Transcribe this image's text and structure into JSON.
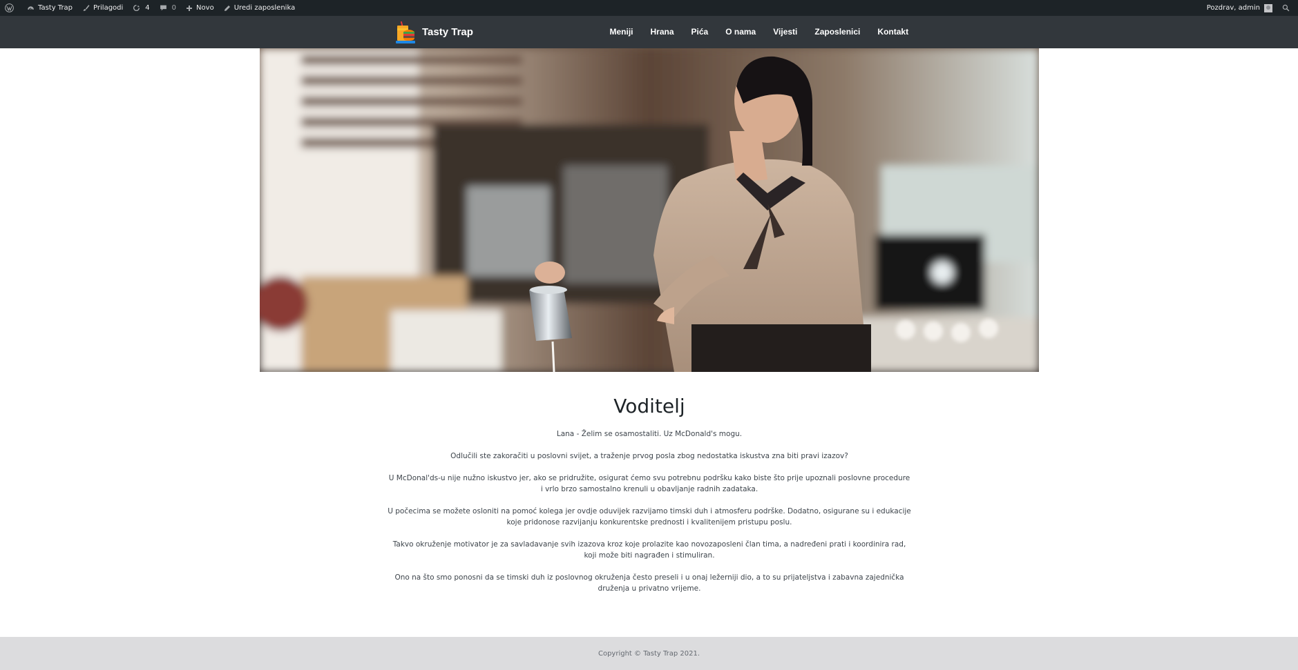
{
  "adminbar": {
    "site_name": "Tasty Trap",
    "customize": "Prilagodi",
    "updates_count": "4",
    "comments_count": "0",
    "new": "Novo",
    "edit": "Uredi zaposlenika",
    "greeting": "Pozdrav, admin"
  },
  "header": {
    "site_title": "Tasty Trap",
    "nav": [
      "Meniji",
      "Hrana",
      "Pića",
      "O nama",
      "Vijesti",
      "Zaposlenici",
      "Kontakt"
    ]
  },
  "hero": {
    "description": "Photo of a barista in a beige shirt and striped neck scarf pouring milk from a steel jug in a café"
  },
  "article": {
    "title": "Voditelj",
    "paragraphs": [
      "Lana - Želim se osamostaliti. Uz McDonald's mogu.",
      "Odlučili ste zakoračiti u poslovni svijet, a traženje prvog posla zbog nedostatka iskustva zna biti pravi izazov?",
      "U McDonal'ds-u nije nužno iskustvo jer, ako se pridružite, osigurat ćemo svu potrebnu podršku kako biste što prije upoznali poslovne procedure i vrlo brzo samostalno krenuli u obavljanje radnih zadataka.",
      "U počecima se možete osloniti na pomoć kolega jer ovdje oduvijek razvijamo timski duh i atmosferu podrške. Dodatno, osigurane su i edukacije koje pridonose razvijanju konkurentske prednosti i kvalitenijem pristupu poslu.",
      "Takvo okruženje motivator je za savladavanje svih izazova kroz koje prolazite kao novozaposleni član tima, a nadređeni prati i koordinira rad, koji može biti nagrađen i stimuliran.",
      "Ono na što smo ponosni da se timski duh iz poslovnog okruženja često preseli i u onaj ležerniji dio, a to su prijateljstva i zabavna zajednička druženja u privatno vrijeme."
    ]
  },
  "footer": {
    "copyright": "Copyright © Tasty Trap 2021."
  },
  "colors": {
    "adminbar_bg": "#1d2327",
    "header_bg": "#32373c",
    "footer_bg": "#dcdcde"
  },
  "icons": [
    "wordpress-icon",
    "dashboard-icon",
    "brush-icon",
    "updates-icon",
    "comment-icon",
    "plus-icon",
    "pencil-icon",
    "search-icon"
  ]
}
